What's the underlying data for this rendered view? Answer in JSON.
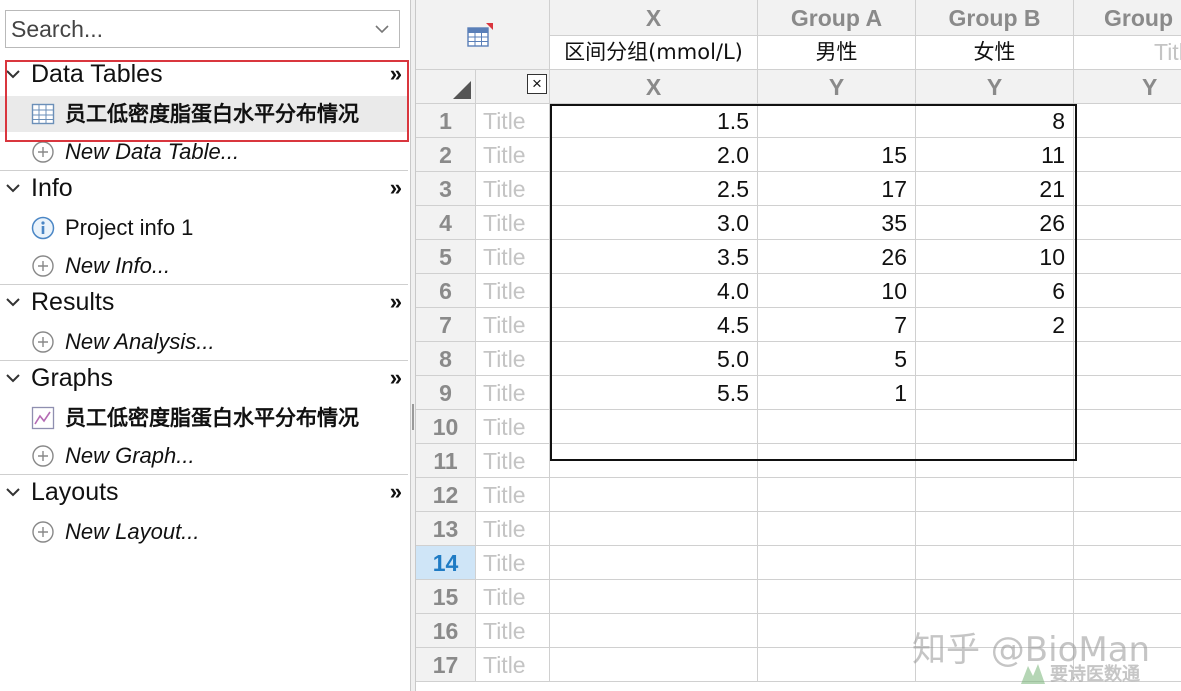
{
  "search": {
    "placeholder": "Search..."
  },
  "navigator": {
    "sections": [
      {
        "label": "Data Tables",
        "more": "»",
        "items": [
          {
            "label": "员工低密度脂蛋白水平分布情况",
            "icon": "data-table-icon"
          },
          {
            "label": "New Data Table...",
            "icon": "add-circle-icon"
          }
        ]
      },
      {
        "label": "Info",
        "more": "»",
        "items": [
          {
            "label": "Project info 1",
            "icon": "info-icon"
          },
          {
            "label": "New Info...",
            "icon": "add-circle-icon"
          }
        ]
      },
      {
        "label": "Results",
        "more": "»",
        "items": [
          {
            "label": "New Analysis...",
            "icon": "add-circle-icon"
          }
        ]
      },
      {
        "label": "Graphs",
        "more": "»",
        "items": [
          {
            "label": "员工低密度脂蛋白水平分布情况",
            "icon": "graph-icon"
          },
          {
            "label": "New Graph...",
            "icon": "add-circle-icon"
          }
        ]
      },
      {
        "label": "Layouts",
        "more": "»",
        "items": [
          {
            "label": "New Layout...",
            "icon": "add-circle-icon"
          }
        ]
      }
    ]
  },
  "table": {
    "columns": [
      {
        "group": "X",
        "title": "区间分组(mmol/L)",
        "kind": "X"
      },
      {
        "group": "Group A",
        "title": "男性",
        "kind": "Y"
      },
      {
        "group": "Group B",
        "title": "女性",
        "kind": "Y"
      },
      {
        "group": "Group",
        "title": "Title",
        "kind": "Y"
      }
    ],
    "close_symbol": "×",
    "row_title_placeholder": "Title",
    "active_row": 14,
    "rows": [
      {
        "n": "1",
        "x": "1.5",
        "a": "",
        "b": "8"
      },
      {
        "n": "2",
        "x": "2.0",
        "a": "15",
        "b": "11"
      },
      {
        "n": "3",
        "x": "2.5",
        "a": "17",
        "b": "21"
      },
      {
        "n": "4",
        "x": "3.0",
        "a": "35",
        "b": "26"
      },
      {
        "n": "5",
        "x": "3.5",
        "a": "26",
        "b": "10"
      },
      {
        "n": "6",
        "x": "4.0",
        "a": "10",
        "b": "6"
      },
      {
        "n": "7",
        "x": "4.5",
        "a": "7",
        "b": "2"
      },
      {
        "n": "8",
        "x": "5.0",
        "a": "5",
        "b": ""
      },
      {
        "n": "9",
        "x": "5.5",
        "a": "1",
        "b": ""
      },
      {
        "n": "10",
        "x": "",
        "a": "",
        "b": ""
      },
      {
        "n": "11",
        "x": "",
        "a": "",
        "b": ""
      },
      {
        "n": "12",
        "x": "",
        "a": "",
        "b": ""
      },
      {
        "n": "13",
        "x": "",
        "a": "",
        "b": ""
      },
      {
        "n": "14",
        "x": "",
        "a": "",
        "b": ""
      },
      {
        "n": "15",
        "x": "",
        "a": "",
        "b": ""
      },
      {
        "n": "16",
        "x": "",
        "a": "",
        "b": ""
      },
      {
        "n": "17",
        "x": "",
        "a": "",
        "b": ""
      }
    ]
  },
  "watermark": {
    "line1": "知乎 @BioMan",
    "line2": "要诗医数通"
  },
  "colors": {
    "selection_box": "#d9363e",
    "active_row": "#1f7bc4",
    "header_text": "#8a8a8a"
  }
}
